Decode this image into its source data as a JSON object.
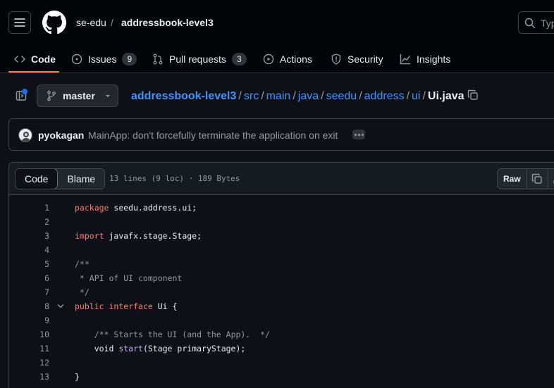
{
  "header": {
    "owner": "se-edu",
    "separator": "/",
    "repo": "addressbook-level3",
    "search_placeholder": "Typ"
  },
  "nav": {
    "code": "Code",
    "issues": "Issues",
    "issues_count": "9",
    "pulls": "Pull requests",
    "pulls_count": "3",
    "actions": "Actions",
    "security": "Security",
    "insights": "Insights"
  },
  "branch": "master",
  "path": {
    "root": "addressbook-level3",
    "segments": [
      "src",
      "main",
      "java",
      "seedu",
      "address",
      "ui"
    ],
    "sep": "/",
    "file": "Ui.java"
  },
  "commit": {
    "author": "pyokagan",
    "message": "MainApp: don't forcefully terminate the application on exit"
  },
  "file": {
    "tab_code": "Code",
    "tab_blame": "Blame",
    "meta": "13 lines (9 loc) · 189 Bytes",
    "raw": "Raw"
  },
  "code_lines": [
    {
      "n": "1",
      "parts": [
        [
          "kw",
          "package"
        ],
        [
          "",
          " seedu.address.ui;"
        ]
      ]
    },
    {
      "n": "2",
      "parts": []
    },
    {
      "n": "3",
      "parts": [
        [
          "kw",
          "import"
        ],
        [
          "",
          " javafx.stage.Stage;"
        ]
      ]
    },
    {
      "n": "4",
      "parts": []
    },
    {
      "n": "5",
      "parts": [
        [
          "cm",
          "/**"
        ]
      ]
    },
    {
      "n": "6",
      "parts": [
        [
          "cm",
          " * API of UI component"
        ]
      ]
    },
    {
      "n": "7",
      "parts": [
        [
          "cm",
          " */"
        ]
      ]
    },
    {
      "n": "8",
      "fold": true,
      "parts": [
        [
          "kw",
          "public"
        ],
        [
          "",
          " "
        ],
        [
          "kw",
          "interface"
        ],
        [
          "",
          " Ui {"
        ]
      ]
    },
    {
      "n": "9",
      "parts": []
    },
    {
      "n": "10",
      "parts": [
        [
          "",
          "    "
        ],
        [
          "cm",
          "/** Starts the UI (and the App).  */"
        ]
      ]
    },
    {
      "n": "11",
      "parts": [
        [
          "",
          "    void "
        ],
        [
          "fn",
          "start"
        ],
        [
          "",
          "(Stage primaryStage);"
        ]
      ]
    },
    {
      "n": "12",
      "parts": []
    },
    {
      "n": "13",
      "parts": [
        [
          "",
          "}"
        ]
      ]
    }
  ],
  "colors": {
    "bg": "#0d1117",
    "header_bg": "#010409",
    "link": "#4493f8",
    "keyword": "#ff7b72",
    "comment": "#9198a1",
    "function": "#d2a8ff",
    "active_underline": "#f78166"
  }
}
